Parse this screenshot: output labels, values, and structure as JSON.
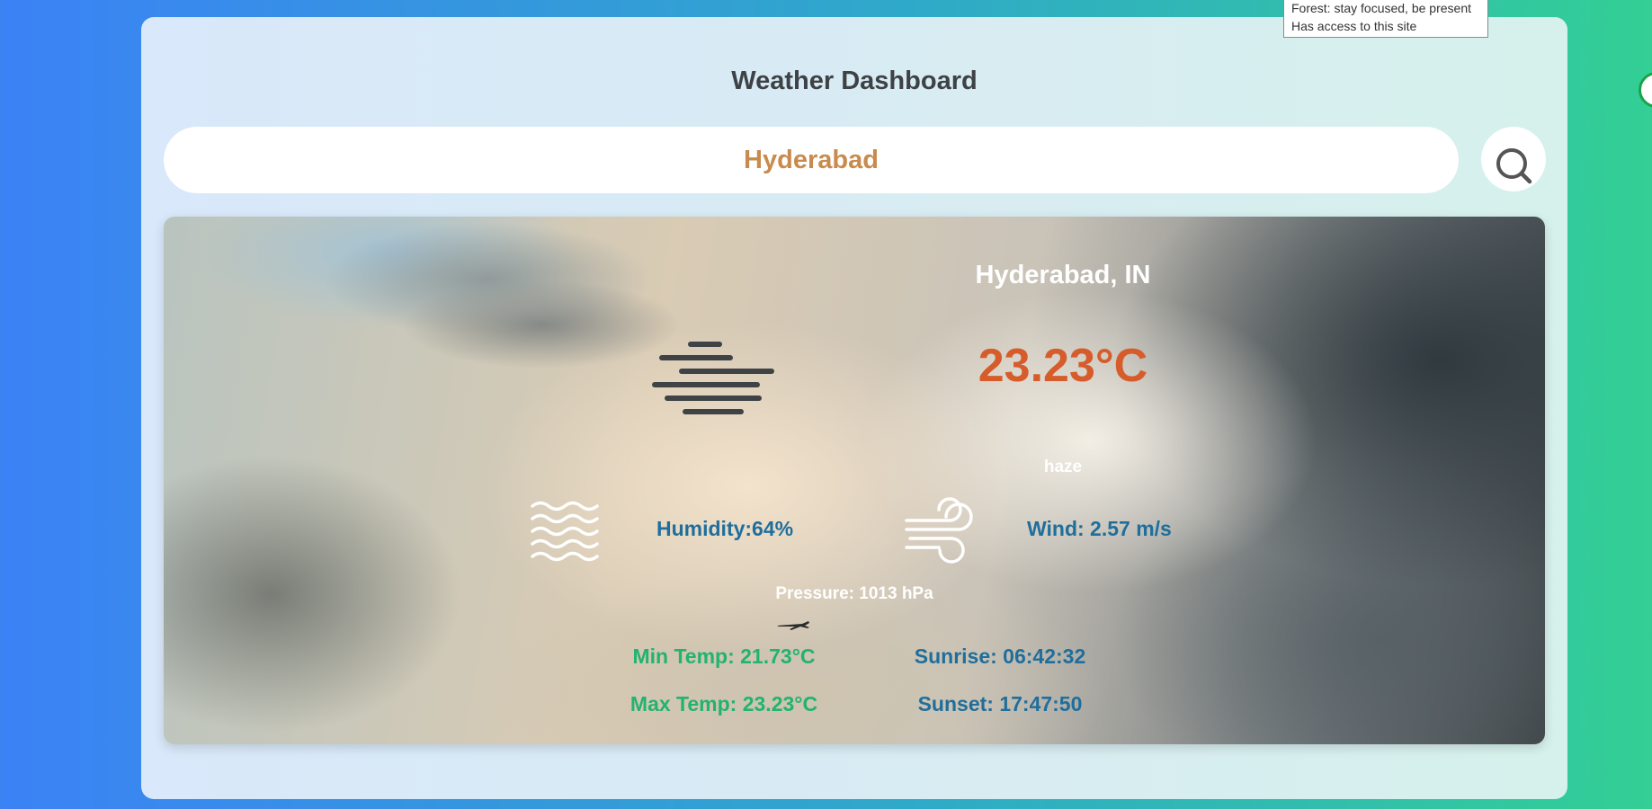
{
  "header": {
    "title": "Weather Dashboard"
  },
  "search": {
    "value": "Hyderabad",
    "placeholder": ""
  },
  "weather": {
    "city": "Hyderabad, IN",
    "temperature": "23.23°C",
    "description": "haze",
    "humidity": "Humidity:64%",
    "wind": "Wind: 2.57 m/s",
    "pressure": "Pressure: 1013 hPa",
    "min_temp": "Min Temp: 21.73°C",
    "max_temp": "Max Temp: 23.23°C",
    "sunrise": "Sunrise: 06:42:32",
    "sunset": "Sunset: 17:47:50"
  },
  "icons": {
    "search": "search-icon",
    "haze": "haze-icon",
    "humidity": "water-waves-icon",
    "wind": "wind-icon"
  },
  "tooltip": {
    "line1": "Forest: stay focused, be present",
    "line2": "Has access to this site"
  },
  "colors": {
    "temperature": "#d65c2b",
    "search_text": "#c98b4d",
    "stat_blue": "#1f6e9c",
    "stat_green": "#22b36f",
    "background_start": "#3b82f6",
    "background_end": "#33cf95"
  }
}
